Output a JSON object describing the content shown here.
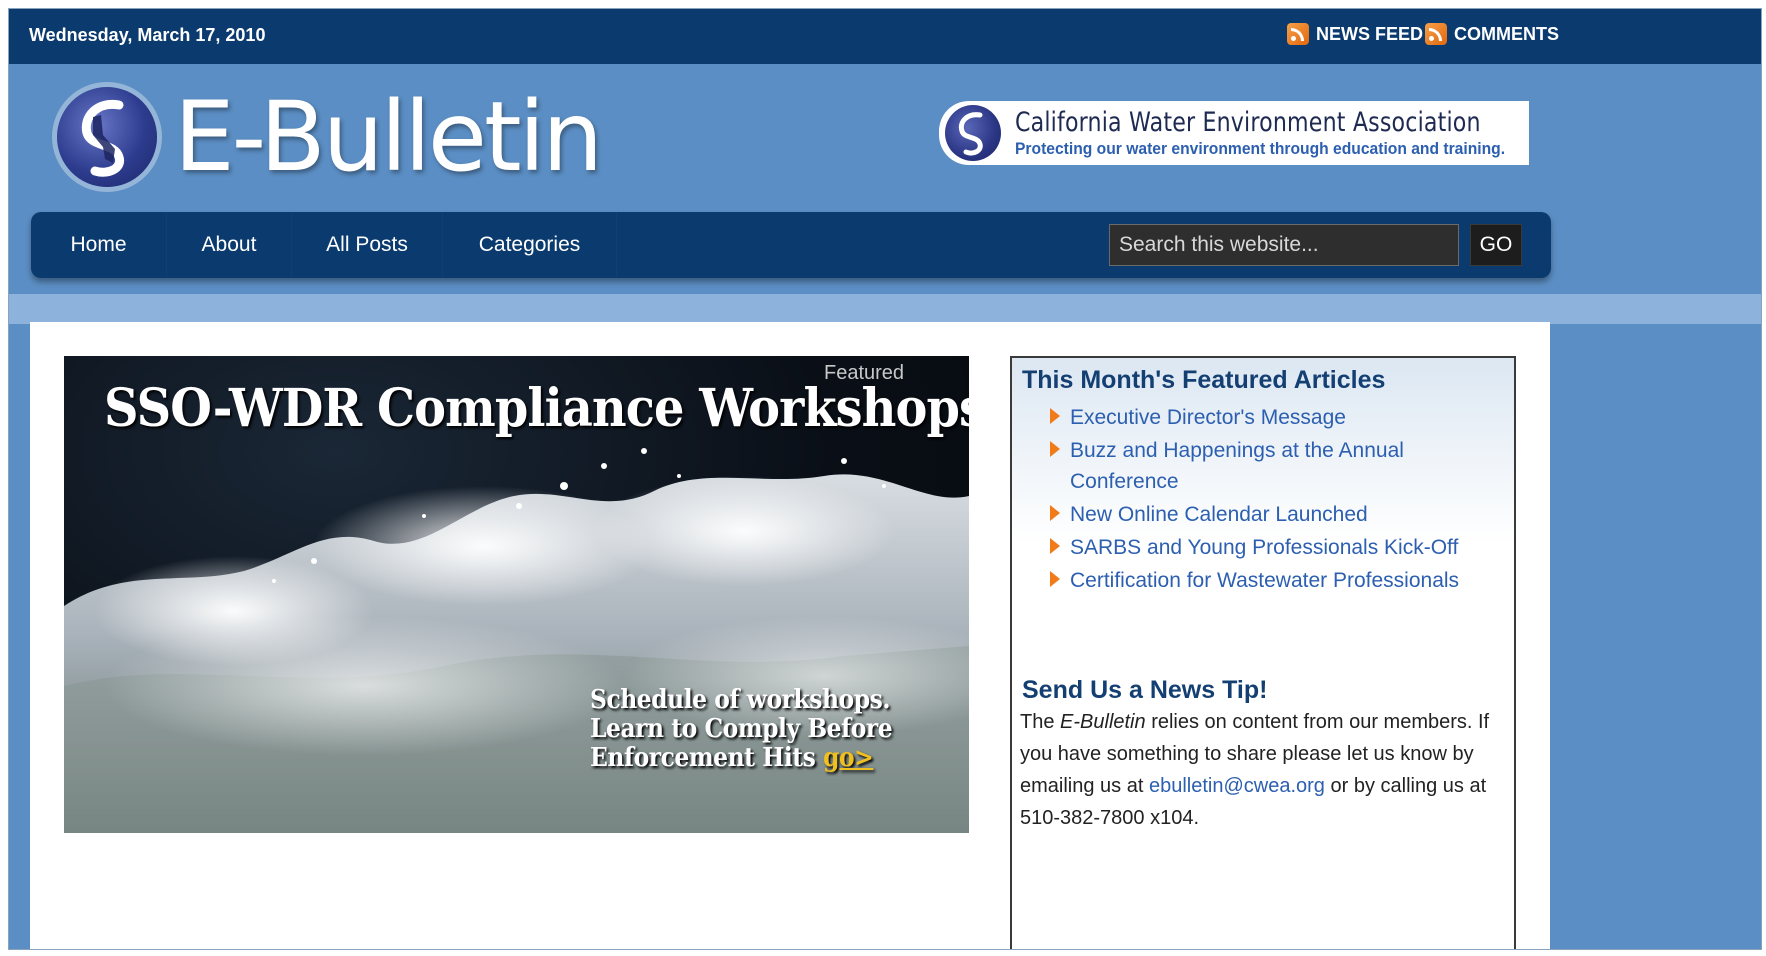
{
  "topbar": {
    "date": "Wednesday, March 17, 2010",
    "news_feed": "NEWS FEED",
    "comments": "COMMENTS"
  },
  "header": {
    "site_title": "E-Bulletin",
    "org_name": "California Water Environment Association",
    "org_tagline": "Protecting our water environment through education and training."
  },
  "nav": {
    "items": [
      {
        "label": "Home"
      },
      {
        "label": "About"
      },
      {
        "label": "All Posts"
      },
      {
        "label": "Categories"
      }
    ],
    "search_placeholder": "Search this website...",
    "go_label": "GO"
  },
  "feature": {
    "tag": "Featured",
    "headline": "SSO-WDR Compliance Workshops",
    "caption_line1": "Schedule of workshops.",
    "caption_line2": "Learn to Comply Before",
    "caption_line3": "Enforcement Hits",
    "go_link": "go>"
  },
  "sidebar": {
    "featured_heading": "This Month's Featured Articles",
    "articles": [
      "Executive Director's Message",
      "Buzz and Happenings at the Annual Conference",
      "New Online Calendar Launched",
      "SARBS and Young Professionals Kick-Off",
      "Certification for Wastewater Professionals"
    ],
    "tip_heading": "Send Us a News Tip!",
    "tip_text_1": "The ",
    "tip_text_em": "E-Bulletin",
    "tip_text_2": " relies on content from our members. If you have something to share please let us know by emailing us at ",
    "tip_email": "ebulletin@cwea.org",
    "tip_text_3": " or by calling us at 510-382-7800 x104."
  },
  "colors": {
    "top_bar": "#0a3a6e",
    "header_bg": "#5b8ec4",
    "link": "#2c5fb0",
    "heading": "#143f73",
    "arrow": "#f07b18"
  }
}
